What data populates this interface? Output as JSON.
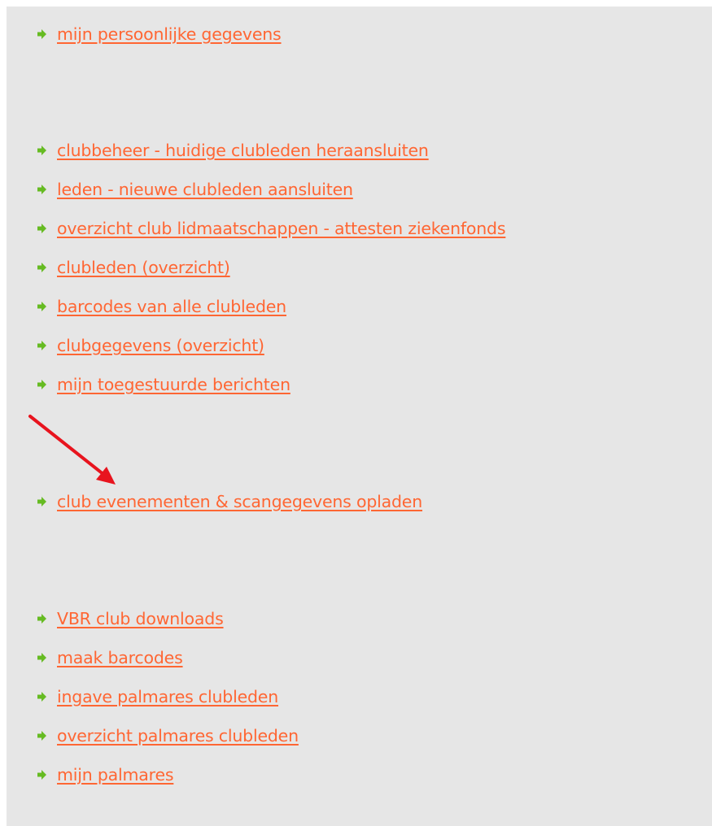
{
  "colors": {
    "panel_background": "#e6e6e6",
    "link": "#ff6633",
    "bullet": "#66bb22",
    "annotation_arrow": "#e8141e"
  },
  "menu": {
    "group_profile": [
      {
        "label": "mijn persoonlijke gegevens",
        "icon": "green-arrow-bullet-icon"
      }
    ],
    "group_club": [
      {
        "label": "clubbeheer - huidige clubleden heraansluiten",
        "icon": "green-arrow-bullet-icon"
      },
      {
        "label": "leden - nieuwe clubleden aansluiten",
        "icon": "green-arrow-bullet-icon"
      },
      {
        "label": "overzicht club lidmaatschappen - attesten ziekenfonds",
        "icon": "green-arrow-bullet-icon"
      },
      {
        "label": "clubleden (overzicht)",
        "icon": "green-arrow-bullet-icon"
      },
      {
        "label": "barcodes van alle clubleden",
        "icon": "green-arrow-bullet-icon"
      },
      {
        "label": "clubgegevens (overzicht)",
        "icon": "green-arrow-bullet-icon"
      },
      {
        "label": "mijn toegestuurde berichten",
        "icon": "green-arrow-bullet-icon"
      }
    ],
    "group_events": [
      {
        "label": "club evenementen & scangegevens opladen",
        "icon": "green-arrow-bullet-icon"
      }
    ],
    "group_downloads": [
      {
        "label": "VBR club downloads",
        "icon": "green-arrow-bullet-icon"
      },
      {
        "label": "maak barcodes",
        "icon": "green-arrow-bullet-icon"
      },
      {
        "label": "ingave palmares clubleden",
        "icon": "green-arrow-bullet-icon"
      },
      {
        "label": "overzicht palmares clubleden",
        "icon": "green-arrow-bullet-icon"
      },
      {
        "label": "mijn palmares",
        "icon": "green-arrow-bullet-icon"
      }
    ]
  },
  "annotation": {
    "icon": "red-annotation-arrow-icon"
  }
}
